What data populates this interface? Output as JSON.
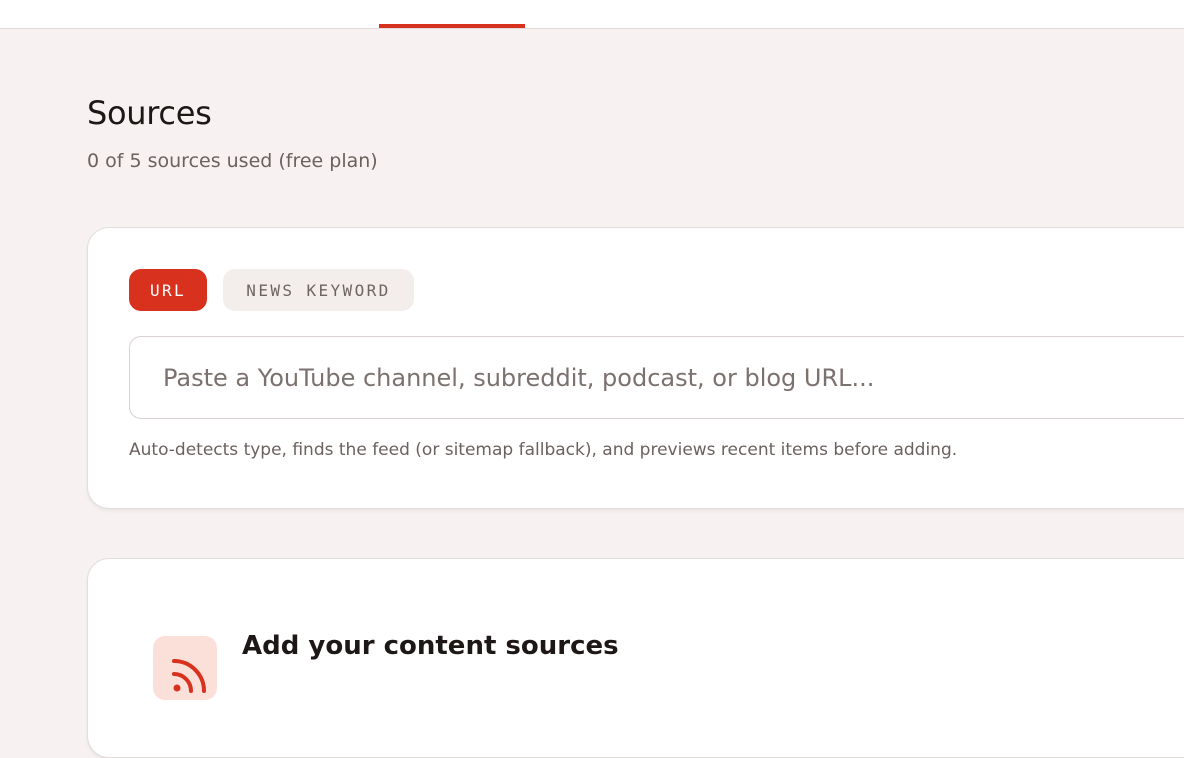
{
  "header": {
    "active_tab_indicator_color": "#d8311d"
  },
  "page": {
    "title": "Sources",
    "subtitle": "0 of 5 sources used (free plan)"
  },
  "add_source": {
    "modes": [
      {
        "label": "URL",
        "active": true
      },
      {
        "label": "NEWS KEYWORD",
        "active": false
      }
    ],
    "input": {
      "value": "",
      "placeholder": "Paste a YouTube channel, subreddit, podcast, or blog URL..."
    },
    "helper_text": "Auto-detects type, finds the feed (or sitemap fallback), and previews recent items before adding."
  },
  "empty_state": {
    "icon": "rss-feed-icon",
    "title": "Add your content sources"
  },
  "colors": {
    "accent": "#d8311d",
    "background": "#f7f2f1",
    "card": "#ffffff",
    "icon_tile": "#fbe0da"
  }
}
